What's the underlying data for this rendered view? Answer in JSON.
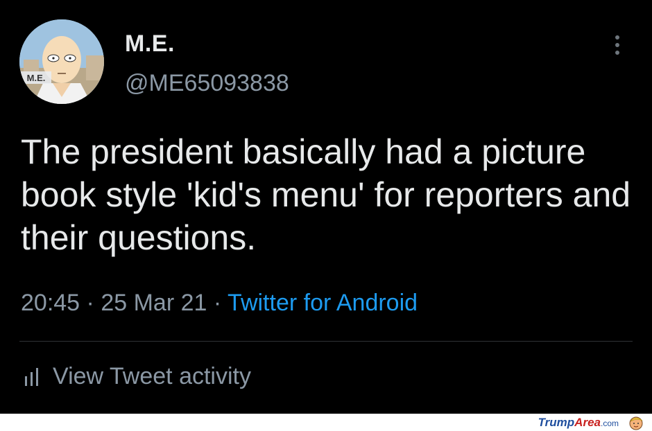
{
  "tweet": {
    "display_name": "M.E.",
    "handle": "@ME65093838",
    "avatar_badge": "M.E.",
    "text": "The president basically had a picture book style 'kid's menu' for reporters and their questions.",
    "time": "20:45",
    "date": "25 Mar 21",
    "source": "Twitter for Android",
    "separator": "·",
    "activity_label": "View Tweet activity",
    "menu_icon": "more-vertical-icon",
    "activity_icon": "bar-chart-icon"
  },
  "watermark": {
    "brand_part1": "Trump",
    "brand_part2": "Area",
    "brand_suffix": ".com"
  },
  "colors": {
    "background": "#000000",
    "primary_text": "#e7e9ea",
    "secondary_text": "#8b98a5",
    "link": "#1d9bf0",
    "divider": "#2f3336"
  }
}
